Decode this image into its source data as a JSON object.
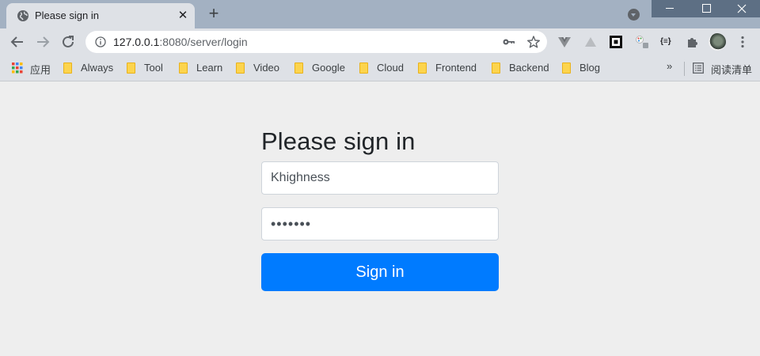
{
  "browser": {
    "tab": {
      "title": "Please sign in",
      "close_glyph": "✕"
    },
    "new_tab_glyph": "+",
    "omnibox": {
      "host": "127.0.0.1",
      "path": ":8080/server/login"
    },
    "bookmarks": {
      "apps_label": "应用",
      "items": [
        {
          "label": "Always"
        },
        {
          "label": "Tool"
        },
        {
          "label": "Learn"
        },
        {
          "label": "Video"
        },
        {
          "label": "Google"
        },
        {
          "label": "Cloud"
        },
        {
          "label": "Frontend"
        },
        {
          "label": "Backend"
        },
        {
          "label": "Blog"
        }
      ],
      "more_glyph": "»",
      "reading_list_label": "阅读清单"
    },
    "extensions_code_label": "{≡}"
  },
  "login": {
    "heading": "Please sign in",
    "username_value": "Khighness",
    "password_value": "•••••••",
    "submit_label": "Sign in"
  },
  "colors": {
    "page_background": "#eeeeee",
    "primary_button": "#007bff",
    "tab_strip": "#a3b1c2",
    "toolbar": "#dee1e6"
  }
}
